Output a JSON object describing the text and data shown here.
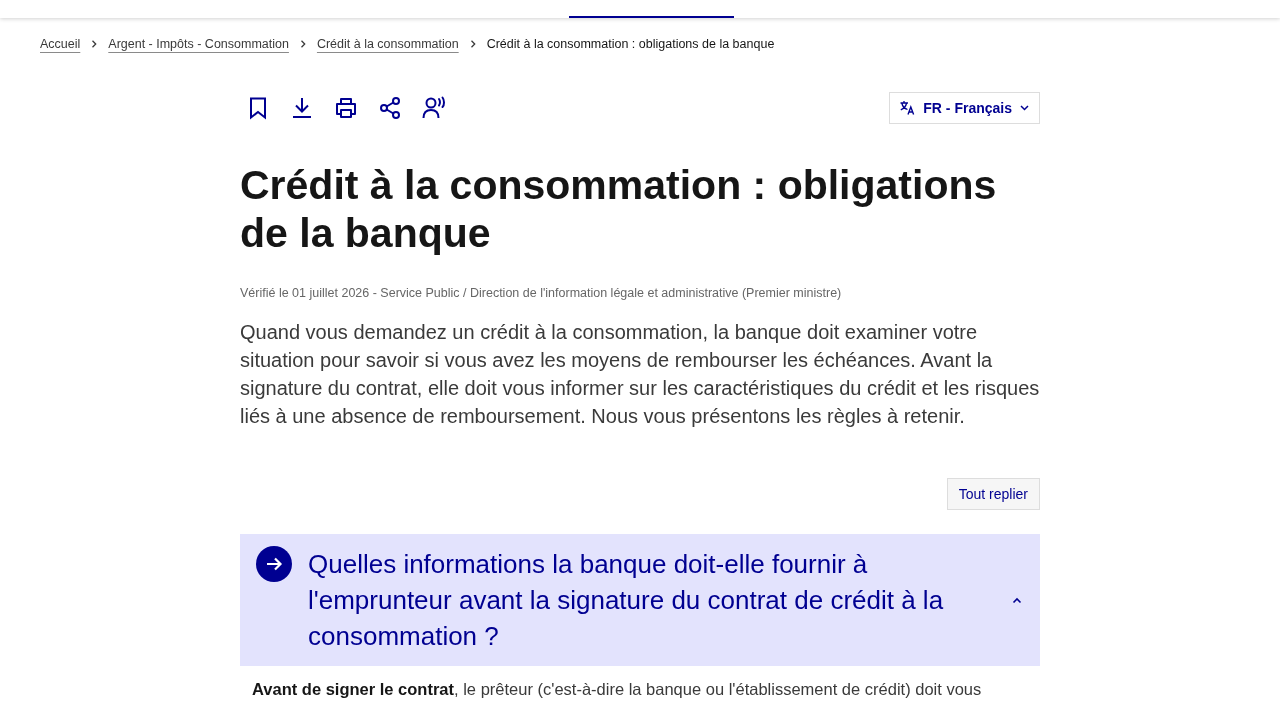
{
  "breadcrumb": [
    {
      "label": "Accueil",
      "kind": "link"
    },
    {
      "label": "Argent - Impôts - Consommation",
      "kind": "link"
    },
    {
      "label": "Crédit à la consommation",
      "kind": "link"
    },
    {
      "label": "Crédit à la consommation : obligations de la banque",
      "kind": "current"
    }
  ],
  "language_button": {
    "label": "FR - Français"
  },
  "title": "Crédit à la consommation : obligations de la banque",
  "meta": "Vérifié le 01 juillet 2026 - Service Public / Direction de l'information légale et administrative (Premier ministre)",
  "intro": "Quand vous demandez un crédit à la consommation, la banque doit examiner votre situation pour savoir si vous avez les moyens de rembourser les échéances. Avant la signature du contrat, elle doit vous informer sur les caractéristiques du crédit et les risques liés à une absence de remboursement. Nous vous présentons les règles à retenir.",
  "collapse_all_button": {
    "label": "Tout replier"
  },
  "accordion": [
    {
      "title": "Quelles informations la banque doit-elle fournir à l'emprunteur avant la signature du contrat de crédit à la consommation ?",
      "expanded": true,
      "body": "**Avant de signer le contrat**, le prêteur (c'est-à-dire la banque ou l'établissement de crédit) doit vous"
    }
  ]
}
